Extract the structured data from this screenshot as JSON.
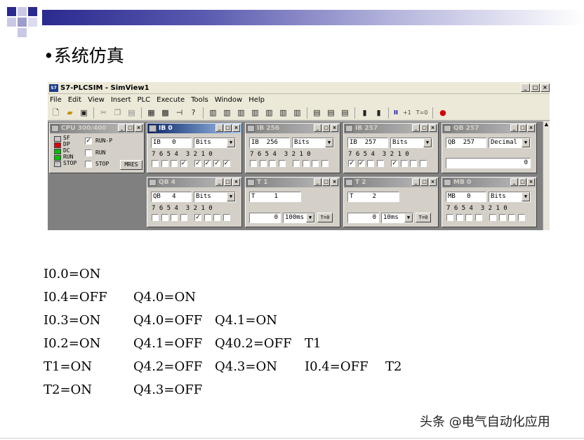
{
  "slide": {
    "title": "•系统仿真",
    "watermark": "头条 @电气自动化应用",
    "accent_colors": {
      "square_dark": "#2b2a8f",
      "square_light": "#9c9ccc"
    }
  },
  "window": {
    "title": "S7-PLCSIM - SimView1",
    "icon_text": "S7",
    "controls": [
      "_",
      "□",
      "×"
    ],
    "menu": [
      "File",
      "Edit",
      "View",
      "Insert",
      "PLC",
      "Execute",
      "Tools",
      "Window",
      "Help"
    ],
    "toolbar": {
      "icons": [
        "new-icon",
        "open-icon",
        "save-icon",
        "cut-icon",
        "copy-icon",
        "paste-icon",
        "cpu-icon",
        "grid-icon",
        "pin-icon",
        "help-icon",
        "ib-icon",
        "qb-icon",
        "mb-icon",
        "timer-icon",
        "counter-icon",
        "generic-icon",
        "vertical-bits-icon",
        "horizontal-bits-icon",
        "vertical-icon",
        "run-icon"
      ],
      "pause_label": "II",
      "step_label": "+1",
      "t0_label": "T=0"
    }
  },
  "panels": {
    "cpu": {
      "title": "CPU 300/400",
      "leds": [
        {
          "label": "SF",
          "color": "#c8c8c8"
        },
        {
          "label": "DP",
          "color": "#e00000"
        },
        {
          "label": "DC",
          "color": "#00c000"
        },
        {
          "label": "RUN",
          "color": "#00c000"
        },
        {
          "label": "STOP",
          "color": "#c8c8c8"
        }
      ],
      "modes": [
        {
          "label": "RUN-P",
          "checked": true
        },
        {
          "label": "RUN",
          "checked": false
        },
        {
          "label": "STOP",
          "checked": false
        }
      ],
      "mres_label": "MRES"
    },
    "ib0": {
      "title": "IB   0",
      "area": "IB",
      "addr": "0",
      "format": "Bits",
      "bits_label": "7 6 5 4  3 2 1 0",
      "bits": [
        false,
        false,
        false,
        true,
        true,
        true,
        true,
        true
      ]
    },
    "ib256": {
      "title": "IB  256",
      "area": "IB",
      "addr": "256",
      "format": "Bits",
      "bits_label": "7 6 5 4  3 2 1 0",
      "bits": [
        false,
        false,
        false,
        false,
        false,
        false,
        false,
        false
      ]
    },
    "ib257": {
      "title": "IB  257",
      "area": "IB",
      "addr": "257",
      "format": "Bits",
      "bits_label": "7 6 5 4  3 2 1 0",
      "bits": [
        true,
        true,
        false,
        false,
        true,
        false,
        false,
        false
      ]
    },
    "qb257": {
      "title": "QB  257",
      "area": "QB",
      "addr": "257",
      "format": "Decimal",
      "value": "0"
    },
    "qb4": {
      "title": "QB   4",
      "area": "QB",
      "addr": "4",
      "format": "Bits",
      "bits_label": "7 6 5 4  3 2 1 0",
      "bits": [
        false,
        false,
        false,
        false,
        true,
        false,
        false,
        false
      ]
    },
    "t1": {
      "title": "T   1",
      "area": "T",
      "addr": "1",
      "value": "0",
      "base": "100ms",
      "t0_label": "T=0"
    },
    "t2": {
      "title": "T   2",
      "area": "T",
      "addr": "2",
      "value": "0",
      "base": "10ms",
      "t0_label": "T=0"
    },
    "mb0": {
      "title": "MB   0",
      "area": "MB",
      "addr": "0",
      "format": "Bits",
      "bits_label": "7 6 5 4  3 2 1 0",
      "bits": [
        false,
        false,
        false,
        false,
        false,
        false,
        false,
        false
      ]
    },
    "ctrl_labels": [
      "_",
      "□",
      "×"
    ]
  },
  "notes": [
    [
      "I0.0=ON"
    ],
    [
      "I0.4=OFF",
      "Q4.0=ON"
    ],
    [
      "I0.3=ON",
      "Q4.0=OFF",
      "Q4.1=ON"
    ],
    [
      "I0.2=ON",
      "Q4.1=OFF",
      "Q40.2=OFF",
      "T1"
    ],
    [
      "T1=ON",
      "Q4.2=OFF",
      "Q4.3=ON",
      "I0.4=OFF",
      "T2"
    ],
    [
      "T2=ON",
      "Q4.3=OFF"
    ]
  ]
}
